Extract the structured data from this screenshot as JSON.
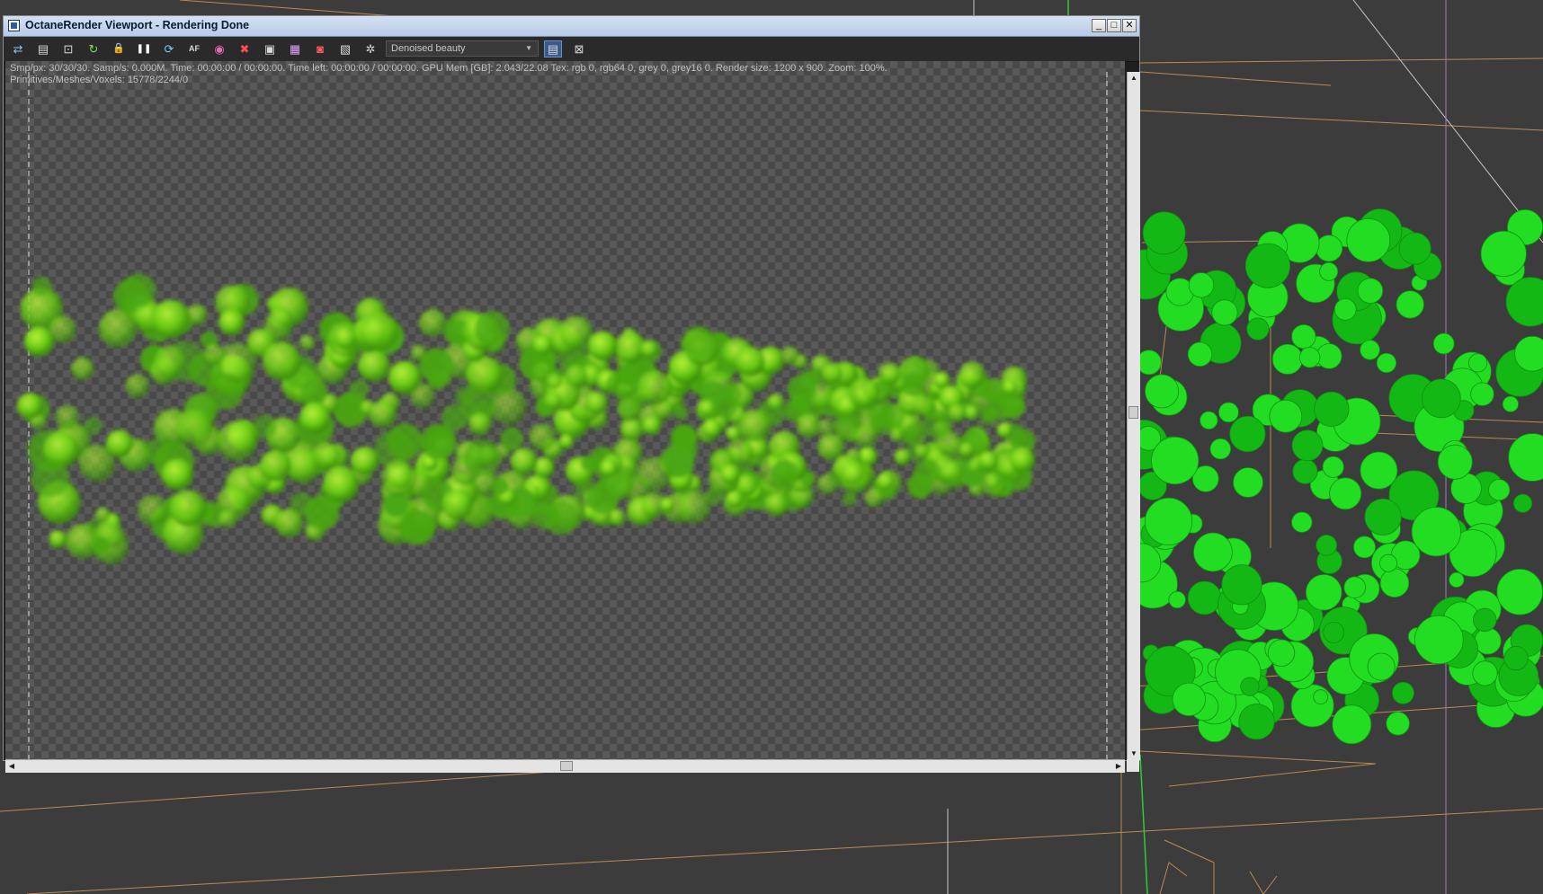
{
  "window": {
    "title": "OctaneRender Viewport - Rendering Done",
    "buttons": {
      "minimize": "_",
      "maximize": "□",
      "close": "✕"
    }
  },
  "toolbar": {
    "tools": [
      {
        "name": "send-scene-icon",
        "glyph": "⇄"
      },
      {
        "name": "save-image-icon",
        "glyph": "▤"
      },
      {
        "name": "zoom-region-icon",
        "glyph": "⊡"
      },
      {
        "name": "restart-render-icon",
        "glyph": "↻"
      },
      {
        "name": "lock-icon",
        "glyph": "🔒"
      },
      {
        "name": "pause-icon",
        "glyph": "❚❚"
      },
      {
        "name": "refresh-icon",
        "glyph": "⟳"
      },
      {
        "name": "af-icon",
        "glyph": "AF"
      },
      {
        "name": "color-picker-icon",
        "glyph": "◉"
      },
      {
        "name": "stop-icon",
        "glyph": "✖"
      },
      {
        "name": "display-icon",
        "glyph": "▣"
      },
      {
        "name": "film-icon",
        "glyph": "▦"
      },
      {
        "name": "camera-icon",
        "glyph": "◙"
      },
      {
        "name": "region-icon",
        "glyph": "▧"
      },
      {
        "name": "settings-icon",
        "glyph": "✲"
      }
    ],
    "render_pass": "Denoised beauty",
    "extra": [
      {
        "name": "layout-toggle-icon",
        "glyph": "▤"
      },
      {
        "name": "fit-view-icon",
        "glyph": "⊠"
      }
    ]
  },
  "stats": {
    "line1": "Smp/px: 30/30/30.   Samp/s: 0.000M.   Time: 00:00:00 / 00:00:00.   Time left: 00:00:00 / 00:00:00.   GPU Mem [GB]: 2.043/22.08   Tex: rgb 0, rgb64 0, grey 0, grey16 0.   Render size: 1200 x 900.   Zoom: 100%.",
    "line2": "Primitives/Meshes/Voxels: 15778/2244/0"
  },
  "colors": {
    "render_green": "#7bdc1a",
    "viewport_green": "#1fd41f",
    "wire_orange": "#c69454",
    "title_gradient": "#c3d4ec"
  }
}
